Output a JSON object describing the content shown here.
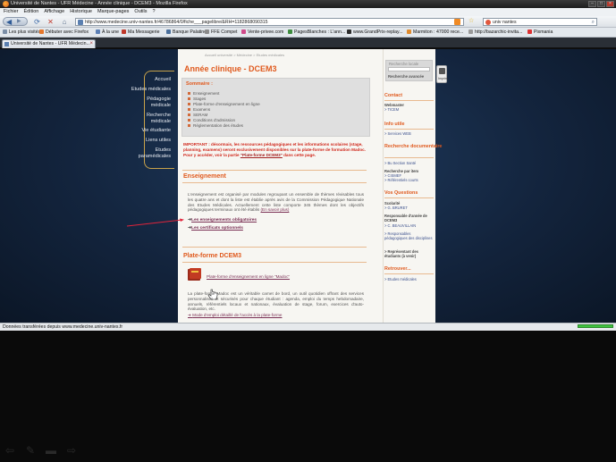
{
  "browser": {
    "window_title": "Université de Nantes - UFR Médecine - Année clinique - DCEM3 - Mozilla Firefox",
    "menu": [
      "Fichier",
      "Édition",
      "Affichage",
      "Historique",
      "Marque-pages",
      "Outils",
      "?"
    ],
    "url": "http://www.medecine.univ-nantes.fr/46786864/0/fiche___pagelibre/&RH=1182868090315",
    "search_value": "univ nantes",
    "bookmarks": [
      "Les plus visités",
      "Débuter avec Firefox",
      "À la une",
      "Ma Messagerie",
      "Banque Palatine",
      "FFE Compet",
      "Vente-privee.com",
      "PagesBlanches : L'ann...",
      "www.GrandPrix-replay...",
      "Marmiton : 47000 rece...",
      "http://bazarchic-invita...",
      "Pixmania"
    ],
    "tab_label": "Université de Nantes - UFR Médecin...",
    "status_text": "Données transférées depuis www.medecine.univ-nantes.fr",
    "progress": 1.0
  },
  "leftnav": [
    "Accueil",
    "Etudes médicales",
    "Pédagogie médicale",
    "Recherche médicale",
    "Vie étudiante",
    "Liens utiles",
    "Etudes paramédicales"
  ],
  "main": {
    "breadcrumb": "Accueil université > Médecine > Etudes médicales",
    "title": "Année clinique - DCEM3",
    "sommaire_title": "Sommaire :",
    "sommaire_items": [
      "Enseignement",
      "Stages",
      "Plate-forme d'enseignement en ligne",
      "Examens",
      "SERAM",
      "Conditions d'admission",
      "Réglementation des études"
    ],
    "important_text": "IMPORTANT : désormais, les ressources pédagogiques et les informations scolaires (stage, planning, examens) seront exclusivement disponibles sur la plate-forme de formation Madoc. Pour y accéder, voir la partie ",
    "important_link": "\"Plate-forme DCEM3\"",
    "important_tail": " dans cette page.",
    "enseignement_title": "Enseignement",
    "enseignement_text": "L'enseignement est organisé par modules regroupant un ensemble de thèmes révisables tous les quatre ans et dont la liste est établie après avis de la Commission Pédagogique Nationale des Etudes Médicales. Actuellement cette liste comporte 345 thèmes dont les objectifs pédagogiques terminaux ont été établis ",
    "enseignement_link": "(En savoir plus)",
    "link_obligatoires": "Les enseignements obligatoires",
    "link_optionnels": "Les certificats optionnels",
    "plateforme_title": "Plate-forme DCEM3",
    "madoc_link": "Plate-forme d'enseignement en ligne \"Madoc\"",
    "madoc_text": "La plate-forme Madoc est un véritable carnet de bord, un outil quotidien offrant des services personnalisés et sécurisés pour chaque étudiant : agenda, emploi du temps hebdomadaire, annuels, référentiels locaux et nationaux, évaluation de stage, forum, exercices d'auto-évaluation, etc.",
    "mode_link": "Mode d'emploi détaillé de l'accès à la plate-forme"
  },
  "right": {
    "search_label": "Recherche locale",
    "search_adv": "Recherche avancée",
    "icon_label": "Imprim.",
    "contact_title": "Contact",
    "contact_lines": [
      "Webmaster",
      "> TICEM"
    ],
    "info_title": "Info utile",
    "info_lines": [
      "> Services WEB"
    ],
    "recherche_title": "Recherche documentaire",
    "recherche_lines": [
      "> Bu Section Santé",
      "Recherche par item",
      "> CISMEF",
      "> Référentiels courts"
    ],
    "questions_title": "Vos Questions",
    "questions_lines": [
      "Scolarité",
      "> G. BRURET",
      "Responsable d'année de DCEM3",
      "> C. BEAUVILLAIN",
      "> Responsables pédagogiques des disciplines",
      "> Représentant des étudiants (à venir)"
    ],
    "retrouver_title": "Retrouver...",
    "retrouver_lines": [
      "> Etudes médicales"
    ]
  },
  "colors": {
    "accent": "#e05a1e",
    "link": "#7a2f54",
    "important": "#d0281c",
    "nav_bg": "#13243d"
  }
}
